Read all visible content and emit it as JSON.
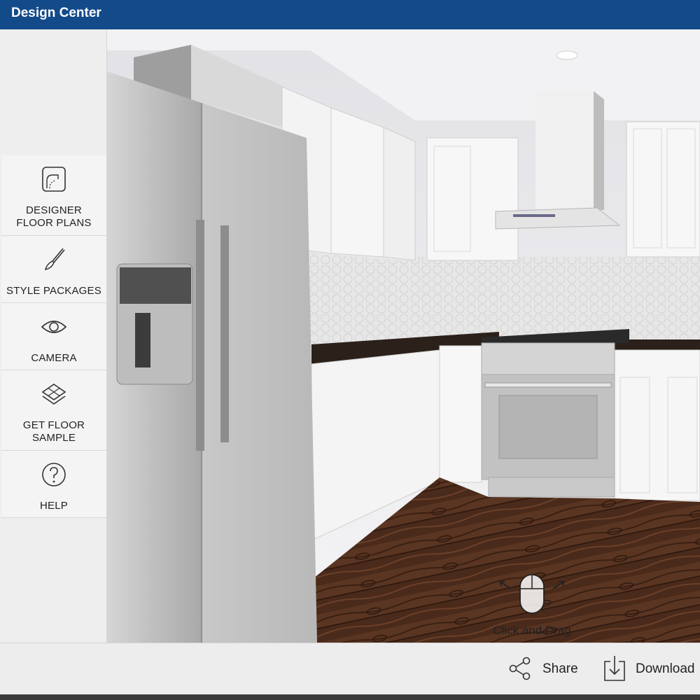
{
  "app": {
    "title": "Design Center"
  },
  "sidebar": {
    "items": [
      {
        "line1": "DESIGNER",
        "line2": "FLOOR PLANS",
        "icon": "floor-plan-icon"
      },
      {
        "line1": "STYLE PACKAGES",
        "line2": "",
        "icon": "paintbrush-icon"
      },
      {
        "line1": "CAMERA",
        "line2": "",
        "icon": "eye-icon"
      },
      {
        "line1": "GET FLOOR",
        "line2": "SAMPLE",
        "icon": "layers-icon"
      },
      {
        "line1": "HELP",
        "line2": "",
        "icon": "question-icon"
      }
    ]
  },
  "viewport": {
    "hint": "Click and Drag",
    "hint_icon": "mouse-icon"
  },
  "footer": {
    "share_label": "Share",
    "share_icon": "share-icon",
    "download_label": "Download",
    "download_icon": "download-icon"
  },
  "colors": {
    "header": "#134a8a",
    "floor": "#4a2a1a",
    "countertop": "#2b201a"
  }
}
